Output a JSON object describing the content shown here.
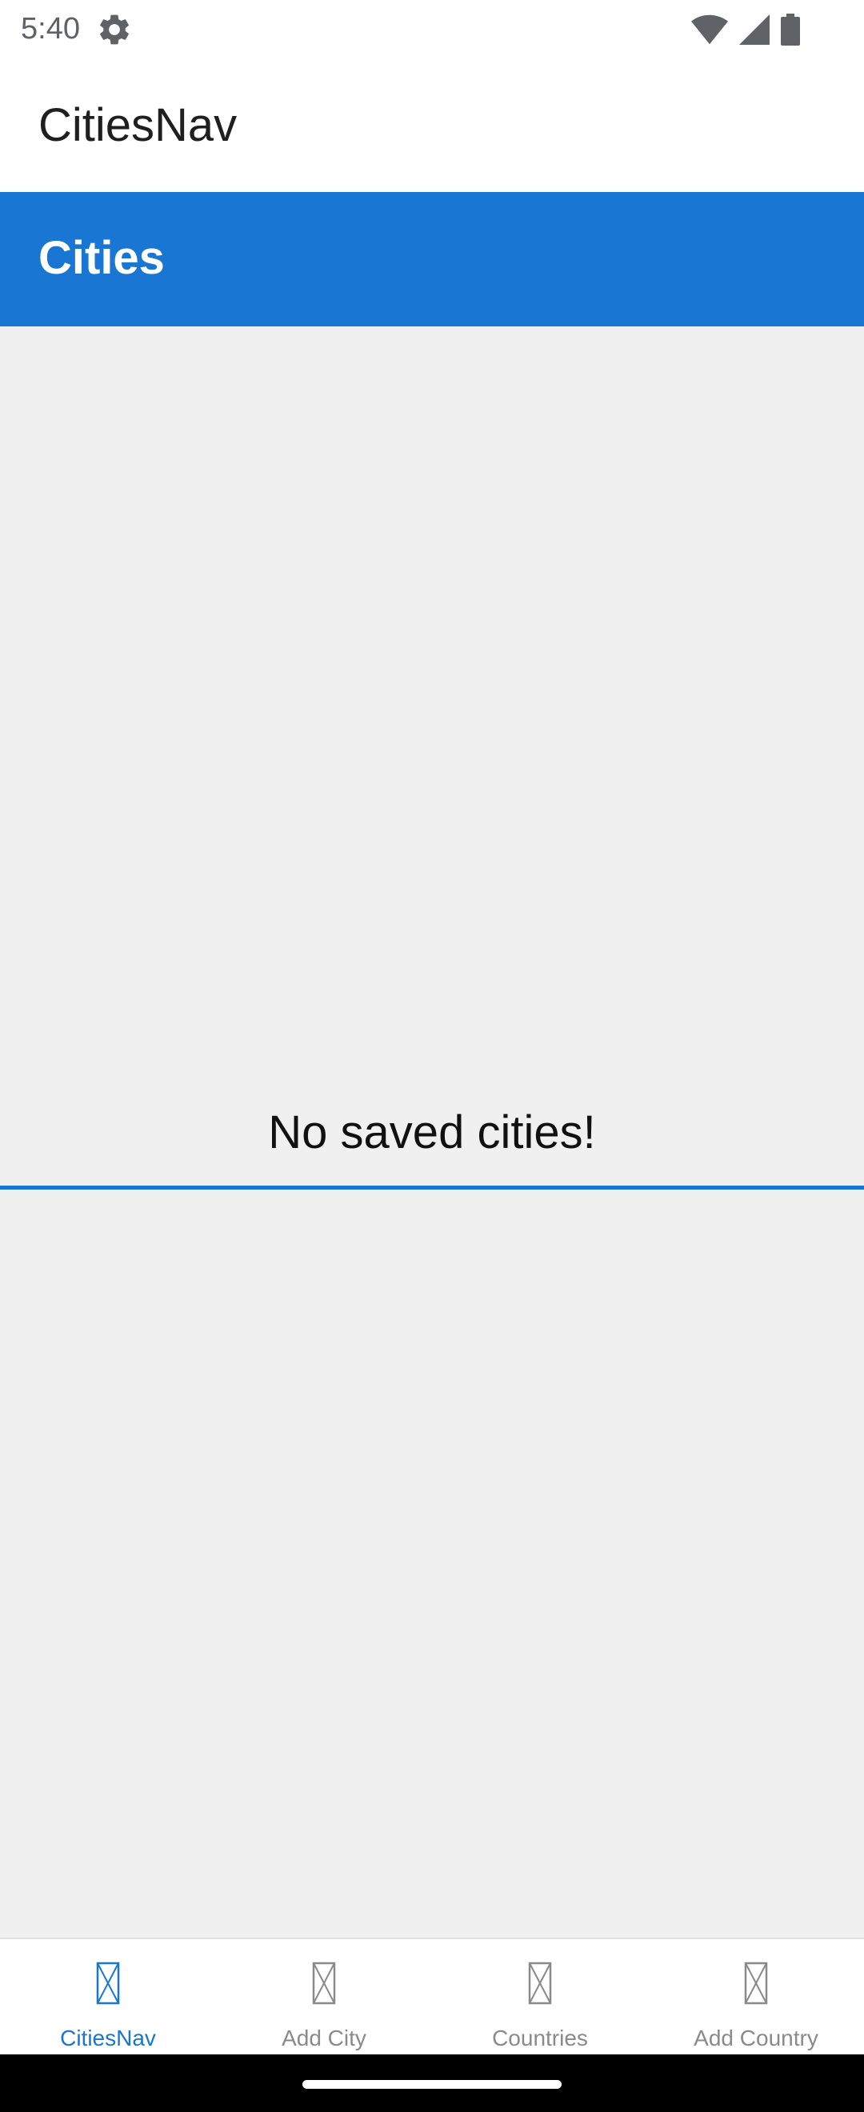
{
  "status_bar": {
    "time": "5:40",
    "icons": [
      "settings-gear-icon",
      "wifi-icon",
      "cell-signal-icon",
      "battery-icon"
    ]
  },
  "app_bar": {
    "title": "CitiesNav"
  },
  "page_header": {
    "title": "Cities"
  },
  "content": {
    "empty_message": "No saved cities!"
  },
  "bottom_nav": {
    "active_index": 0,
    "items": [
      {
        "label": "CitiesNav",
        "icon": "placeholder-glyph-icon"
      },
      {
        "label": "Add City",
        "icon": "placeholder-glyph-icon"
      },
      {
        "label": "Countries",
        "icon": "placeholder-glyph-icon"
      },
      {
        "label": "Add Country",
        "icon": "placeholder-glyph-icon"
      }
    ]
  },
  "colors": {
    "accent": "#1976d2",
    "background": "#f0f0f0",
    "inactive_text": "#8a8a8a"
  }
}
